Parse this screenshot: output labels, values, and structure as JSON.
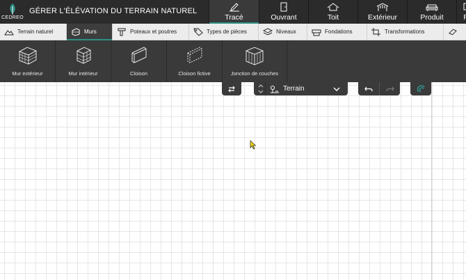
{
  "app": {
    "logo_text": "CEDREO",
    "page_title": "GÉRER L'ÉLÉVATION DU TERRAIN NATUREL"
  },
  "modes": [
    {
      "label": "Tracé",
      "icon": "pencil-icon",
      "active": true
    },
    {
      "label": "Ouvrant",
      "icon": "door-icon",
      "active": false
    },
    {
      "label": "Toit",
      "icon": "roof-icon",
      "active": false
    },
    {
      "label": "Extérieur",
      "icon": "pergola-icon",
      "active": false
    },
    {
      "label": "Produit",
      "icon": "sofa-icon",
      "active": false
    },
    {
      "label": "R",
      "icon": "render-icon",
      "active": false
    }
  ],
  "tabs": [
    {
      "label": "Terrain naturel",
      "icon": "terrain-icon",
      "active": false
    },
    {
      "label": "Murs",
      "icon": "wall-icon",
      "active": true
    },
    {
      "label": "Poteaux et poutres",
      "icon": "beam-icon",
      "active": false
    },
    {
      "label": "Types de pièces",
      "icon": "tag-icon",
      "active": false
    },
    {
      "label": "Niveaux",
      "icon": "layers-icon",
      "active": false
    },
    {
      "label": "Fondations",
      "icon": "foundation-icon",
      "active": false
    },
    {
      "label": "Transformations",
      "icon": "crop-icon",
      "active": false
    },
    {
      "label": "",
      "icon": "more-icon",
      "active": false
    }
  ],
  "tools": [
    {
      "label": "Mur extérieur",
      "icon": "exterior-wall-icon"
    },
    {
      "label": "Mur intérieur",
      "icon": "interior-wall-icon"
    },
    {
      "label": "Cloison",
      "icon": "partition-icon"
    },
    {
      "label": "Cloison fictive",
      "icon": "virtual-partition-icon"
    },
    {
      "label": "Jonction de couches",
      "icon": "layer-junction-icon"
    }
  ],
  "floating": {
    "swap_icon": "swap-icon",
    "level_selector": {
      "value": "Terrain",
      "icon": "terrain-level-icon"
    },
    "undo_icon": "undo-icon",
    "redo_icon": "redo-icon",
    "magnet_icon": "magnet-icon"
  },
  "colors": {
    "accent": "#2f8f84",
    "header_bg": "#2b2b2b",
    "panel_bg": "#3a3a3a",
    "tabbar_bg": "#ececec",
    "cursor": "#f2d60e"
  }
}
